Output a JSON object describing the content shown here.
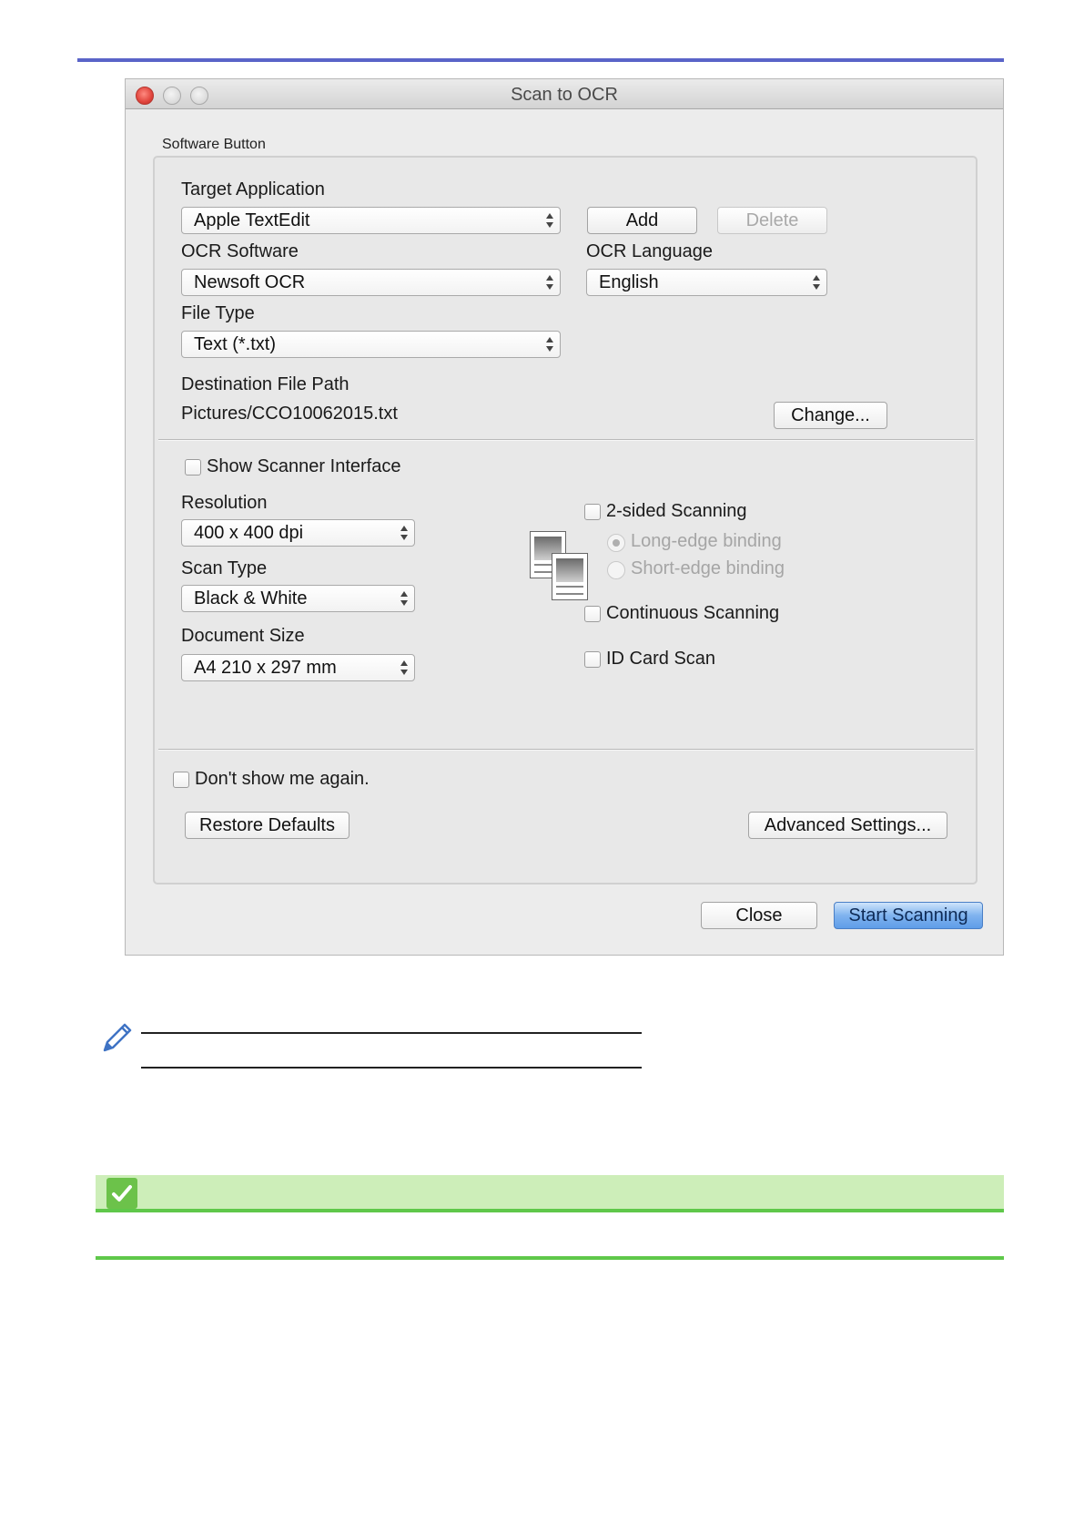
{
  "window": {
    "title": "Scan to OCR"
  },
  "group": {
    "label": "Software Button"
  },
  "target_application": {
    "label": "Target Application",
    "value": "Apple TextEdit"
  },
  "buttons": {
    "add": "Add",
    "delete": "Delete",
    "change": "Change...",
    "restore_defaults": "Restore Defaults",
    "advanced_settings": "Advanced Settings...",
    "close": "Close",
    "start_scanning": "Start Scanning"
  },
  "ocr_software": {
    "label": "OCR Software",
    "value": "Newsoft OCR"
  },
  "ocr_language": {
    "label": "OCR Language",
    "value": "English"
  },
  "file_type": {
    "label": "File Type",
    "value": "Text (*.txt)"
  },
  "destination": {
    "label": "Destination File Path",
    "value": "Pictures/CCO10062015.txt"
  },
  "show_scanner_interface": {
    "label": "Show Scanner Interface",
    "checked": false
  },
  "resolution": {
    "label": "Resolution",
    "value": "400 x 400 dpi"
  },
  "scan_type": {
    "label": "Scan Type",
    "value": "Black & White"
  },
  "document_size": {
    "label": "Document Size",
    "value": "A4 210 x 297 mm"
  },
  "two_sided": {
    "label": "2-sided Scanning",
    "checked": false,
    "options": [
      {
        "label": "Long-edge binding",
        "selected": true
      },
      {
        "label": "Short-edge binding",
        "selected": false
      }
    ]
  },
  "continuous_scanning": {
    "label": "Continuous Scanning",
    "checked": false
  },
  "id_card_scan": {
    "label": "ID Card Scan",
    "checked": false
  },
  "dont_show": {
    "label": "Don't show me again.",
    "checked": false
  },
  "colors": {
    "top_rule": "#5a64c8",
    "primary_button": "#6aa6ec",
    "related_bar": "#cdeeb9",
    "related_accent": "#5fc84a"
  },
  "icons": {
    "note": "pencil-icon",
    "related": "checkmark-icon",
    "duplex": "duplex-pages-icon"
  }
}
